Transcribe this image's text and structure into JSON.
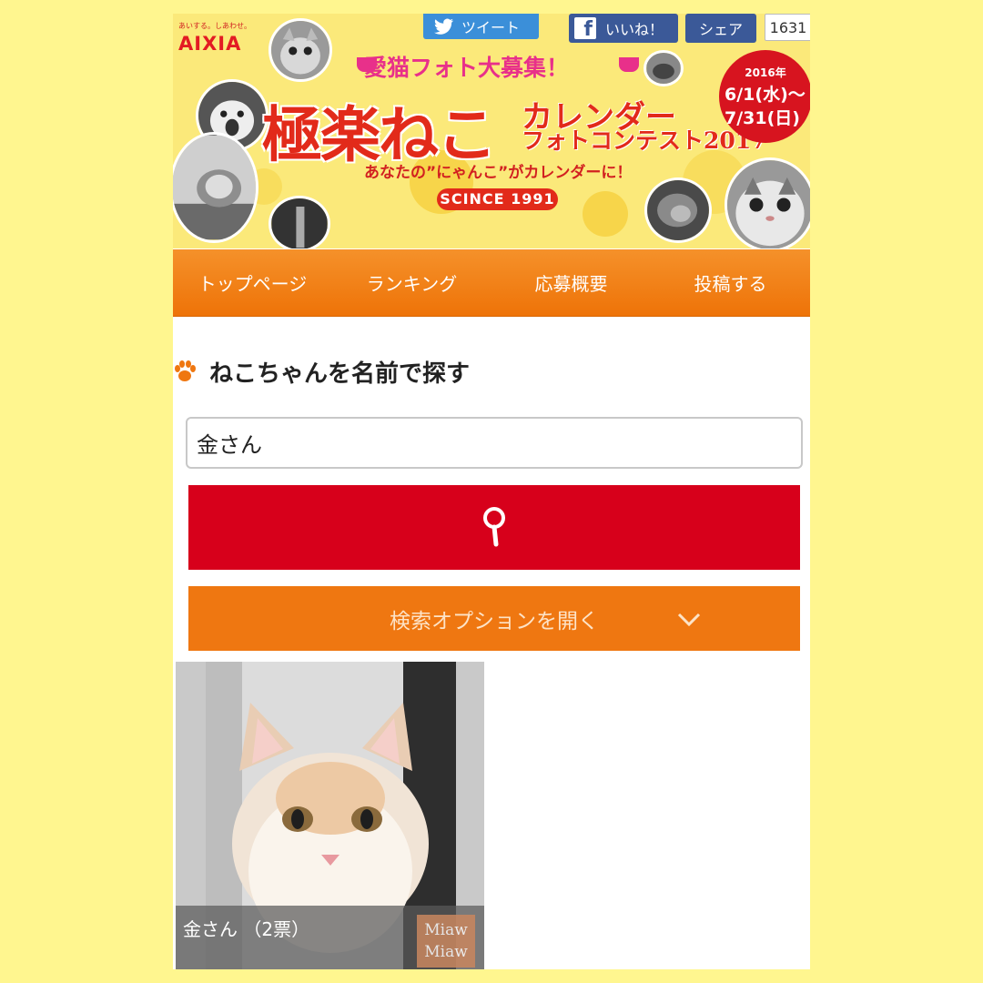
{
  "social": {
    "tweet": "ツイート",
    "like": "いいね！",
    "share": "シェア",
    "count": "1631"
  },
  "banner": {
    "brand_tagline": "あいする。しあわせ。",
    "brand": "AIXIA",
    "subtitle": "愛猫フォト大募集！",
    "title": "極楽ねこ",
    "title_line2a": "カレンダー",
    "title_line2b": "フォトコンテスト2017",
    "tagline": "あなたの”にゃんこ”がカレンダーに！",
    "since_badge": "SCINCE 1991",
    "date_year": "2016年",
    "date_start": "6/1(水)～",
    "date_end": "7/31(日)"
  },
  "nav": {
    "items": [
      "トップページ",
      "ランキング",
      "応募概要",
      "投稿する"
    ]
  },
  "search": {
    "heading": "ねこちゃんを名前で探す",
    "input_value": "金さん",
    "options_label": "検索オプションを開く"
  },
  "results": [
    {
      "caption": "金さん （2票）",
      "watermark_line1": "Miaw",
      "watermark_line2": "Miaw"
    }
  ],
  "colors": {
    "page_background": "#fff68f",
    "nav_orange": "#ef7711",
    "search_red": "#d7001b",
    "title_red": "#e22a1a",
    "subtitle_pink": "#e8308a"
  },
  "icons": [
    "twitter-icon",
    "facebook-icon",
    "paw-icon",
    "search-icon",
    "chevron-down-icon"
  ]
}
